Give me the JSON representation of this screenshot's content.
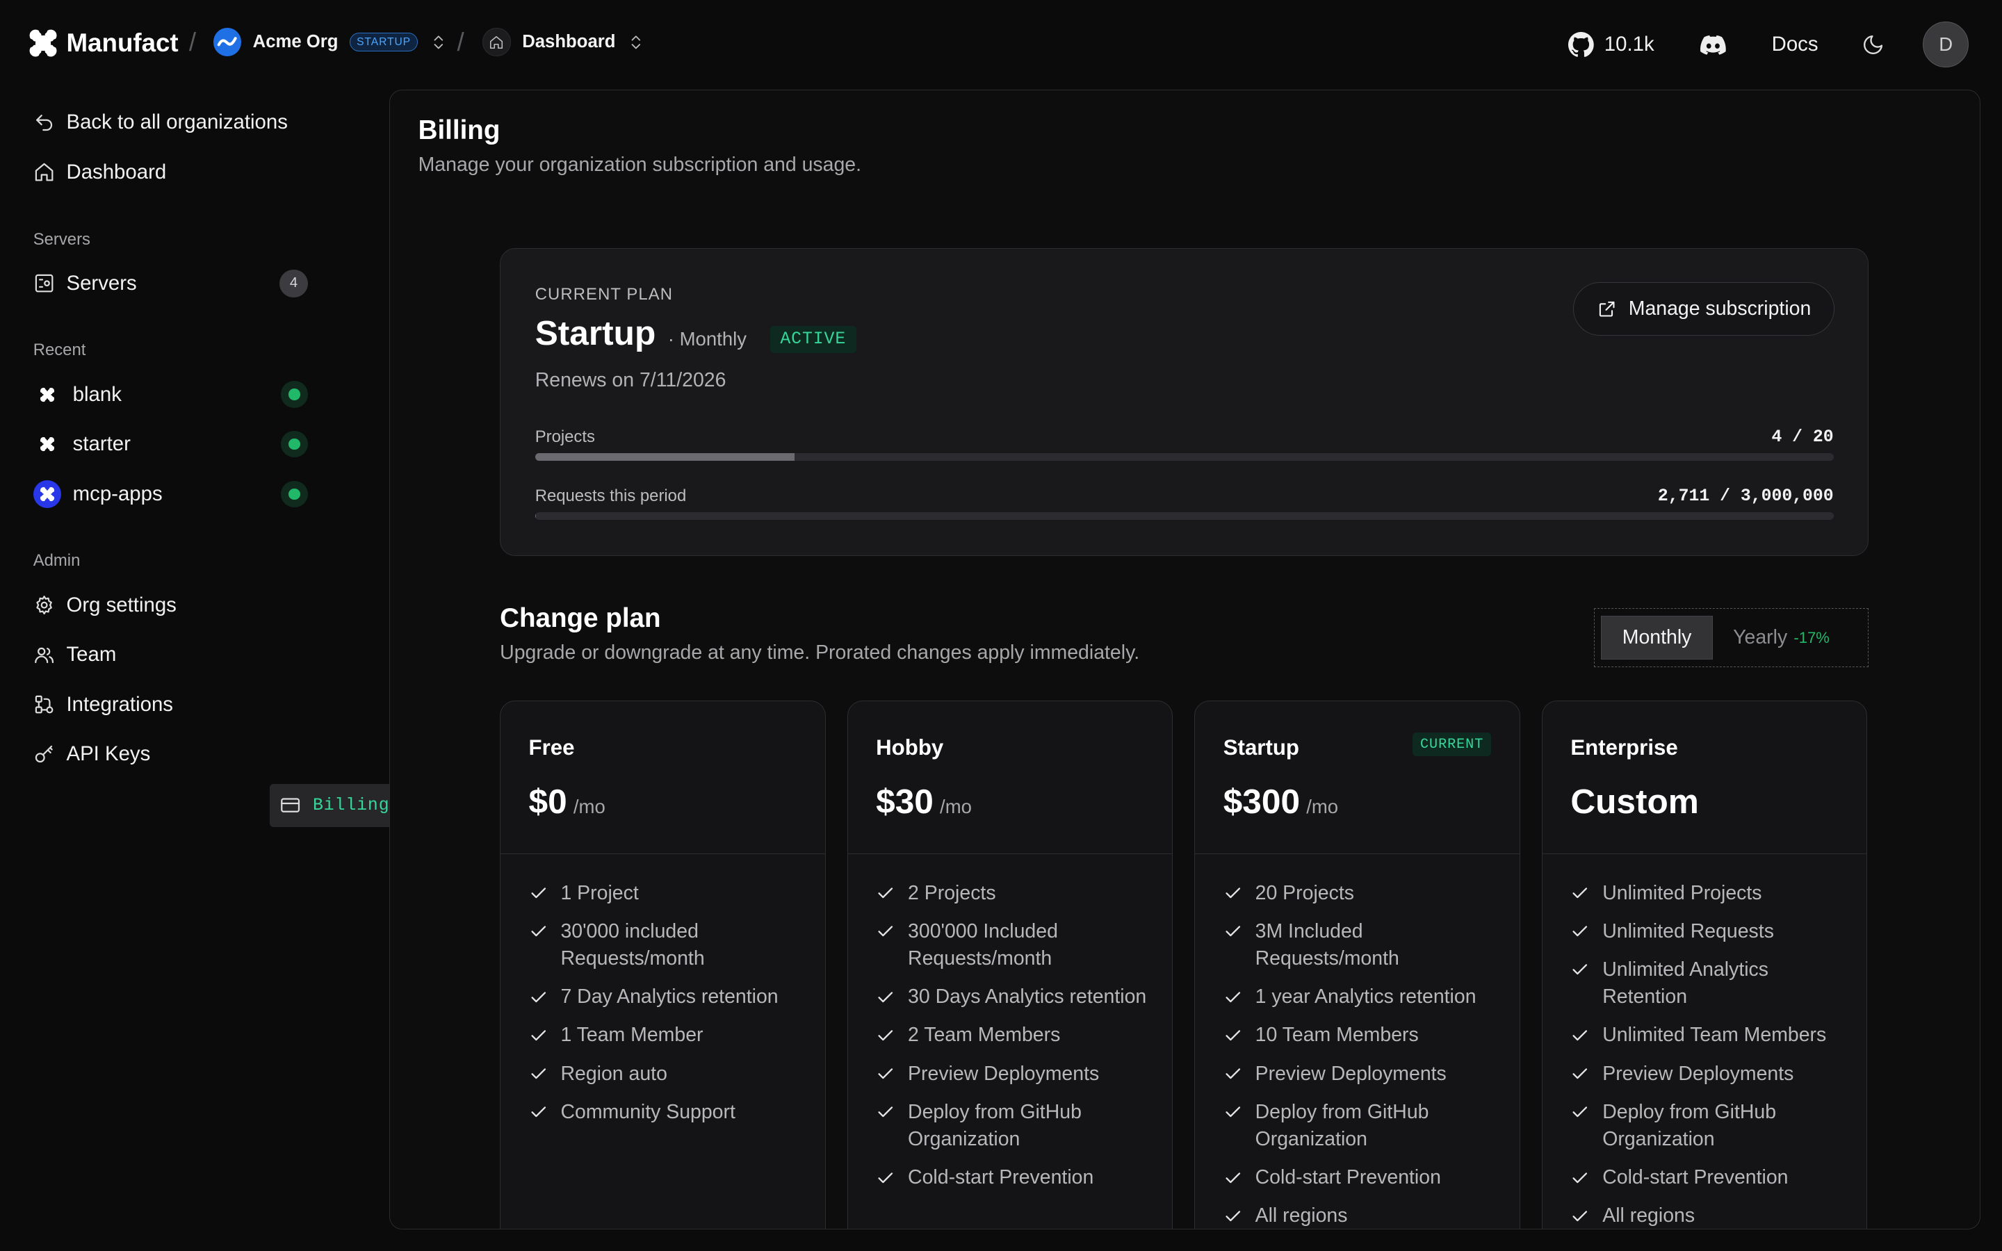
{
  "brand": {
    "name": "Manufact"
  },
  "org": {
    "name": "Acme Org",
    "tier": "STARTUP"
  },
  "page_switch": {
    "label": "Dashboard"
  },
  "header": {
    "stars": "10.1k",
    "docs": "Docs",
    "avatar_initial": "D"
  },
  "sidebar": {
    "back": "Back to all organizations",
    "dashboard": "Dashboard",
    "servers_section": "Servers",
    "servers": {
      "label": "Servers",
      "count": "4"
    },
    "recent_section": "Recent",
    "recent": [
      {
        "label": "blank"
      },
      {
        "label": "starter"
      },
      {
        "label": "mcp-apps"
      }
    ],
    "admin_section": "Admin",
    "admin": [
      {
        "label": "Org settings"
      },
      {
        "label": "Team"
      },
      {
        "label": "Integrations"
      },
      {
        "label": "API Keys"
      },
      {
        "label": "Billing"
      }
    ]
  },
  "billing": {
    "title": "Billing",
    "subtitle": "Manage your organization subscription and usage."
  },
  "current_plan": {
    "label": "CURRENT PLAN",
    "name": "Startup",
    "interval": "· Monthly",
    "status": "ACTIVE",
    "renews": "Renews on 7/11/2026",
    "manage_label": "Manage subscription",
    "usage": [
      {
        "label": "Projects",
        "value": "4 / 20",
        "fraction": 0.2
      },
      {
        "label": "Requests this period",
        "value": "2,711 / 3,000,000",
        "fraction": 0.0009
      }
    ]
  },
  "change_plan": {
    "title": "Change plan",
    "subtitle": "Upgrade or downgrade at any time. Prorated changes apply immediately.",
    "monthly": "Monthly",
    "yearly": "Yearly",
    "yearly_discount": "-17%"
  },
  "plans": [
    {
      "name": "Free",
      "price": "$0",
      "per": "/mo",
      "current": "",
      "features": [
        "1 Project",
        "30'000 included Requests/month",
        "7 Day Analytics retention",
        "1 Team Member",
        "Region auto",
        "Community Support"
      ]
    },
    {
      "name": "Hobby",
      "price": "$30",
      "per": "/mo",
      "current": "",
      "features": [
        "2 Projects",
        "300'000 Included Requests/month",
        "30 Days Analytics retention",
        "2 Team Members",
        "Preview Deployments",
        "Deploy from GitHub Organization",
        "Cold-start Prevention"
      ]
    },
    {
      "name": "Startup",
      "price": "$300",
      "per": "/mo",
      "current": "CURRENT",
      "features": [
        "20 Projects",
        "3M Included Requests/month",
        "1 year Analytics retention",
        "10 Team Members",
        "Preview Deployments",
        "Deploy from GitHub Organization",
        "Cold-start Prevention",
        "All regions"
      ]
    },
    {
      "name": "Enterprise",
      "price": "Custom",
      "per": "",
      "current": "",
      "features": [
        "Unlimited Projects",
        "Unlimited Requests",
        "Unlimited Analytics Retention",
        "Unlimited Team Members",
        "Preview Deployments",
        "Deploy from GitHub Organization",
        "Cold-start Prevention",
        "All regions"
      ]
    }
  ],
  "colors": {
    "background": "#0b0b0c",
    "accent_green": "#22b86a",
    "tier_blue": "#4aa6ff",
    "active_bg": "#27272a"
  }
}
